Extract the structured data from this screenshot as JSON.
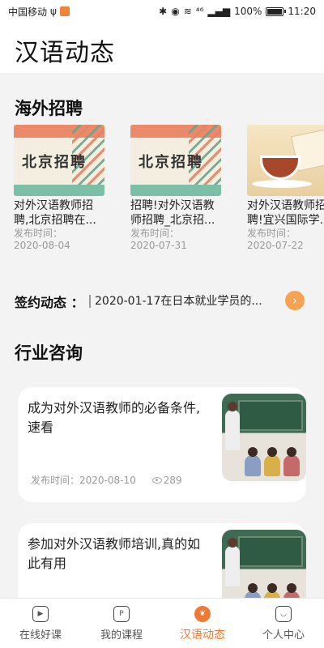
{
  "status_bar": {
    "carrier": "中国移动",
    "usb_glyph": "ψ",
    "network": "⁴⁶",
    "battery_percent": "100%",
    "time": "11:20"
  },
  "header": {
    "title": "汉语动态"
  },
  "overseas": {
    "title": "海外招聘",
    "items": [
      {
        "thumb_text": "北京招聘",
        "title": "对外汉语教师招聘,北京招聘在...",
        "label": "发布时间：",
        "date": "2020-08-04"
      },
      {
        "thumb_text": "北京招聘",
        "title": "招聘!对外汉语教师招聘_北京招...",
        "label": "发布时间：",
        "date": "2020-07-31"
      },
      {
        "thumb_text": "",
        "title": "对外汉语教师招聘!宜兴国际学...",
        "label": "发布时间：",
        "date": "2020-07-22"
      }
    ]
  },
  "signing": {
    "label": "签约动态 ：",
    "text": "2020-01-17在日本就业学员的...",
    "arrow_glyph": "›"
  },
  "industry": {
    "title": "行业咨询",
    "items": [
      {
        "title": "成为对外汉语教师的必备条件,速看",
        "date_label": "发布时间：2020-08-10",
        "views": "289"
      },
      {
        "title": "参加对外汉语教师培训,真的如此有用",
        "date_label": "",
        "views": ""
      }
    ]
  },
  "tabs": [
    {
      "label": "在线好课",
      "icon": "play-icon",
      "glyph": "▶",
      "active": false
    },
    {
      "label": "我的课程",
      "icon": "bookmark-icon",
      "glyph": "P",
      "active": false
    },
    {
      "label": "汉语动态",
      "icon": "leaf-icon",
      "glyph": "❦",
      "active": true
    },
    {
      "label": "个人中心",
      "icon": "smile-icon",
      "glyph": "◡",
      "active": false
    }
  ],
  "colors": {
    "accent": "#f07a33",
    "arrow": "#f5a352"
  }
}
